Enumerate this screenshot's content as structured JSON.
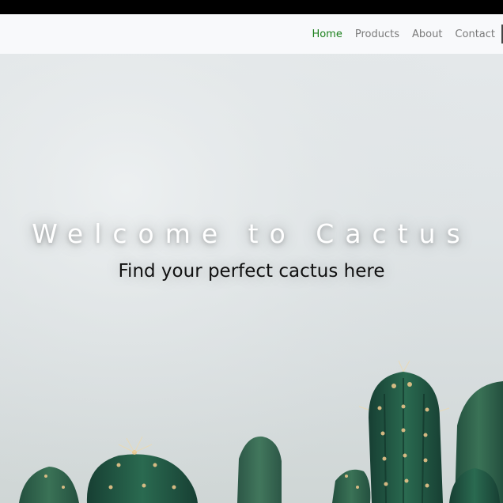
{
  "nav": {
    "items": [
      {
        "label": "Home",
        "active": true
      },
      {
        "label": "Products",
        "active": false
      },
      {
        "label": "About",
        "active": false
      },
      {
        "label": "Contact",
        "active": false
      }
    ]
  },
  "hero": {
    "title": "Welcome to Cactus",
    "subtitle": "Find your perfect cactus here"
  },
  "colors": {
    "active_link": "#1a7f1a",
    "inactive_link": "#7a7a7a",
    "navbar_bg": "#f8f9fb",
    "cactus_green": "#1f5a45"
  }
}
